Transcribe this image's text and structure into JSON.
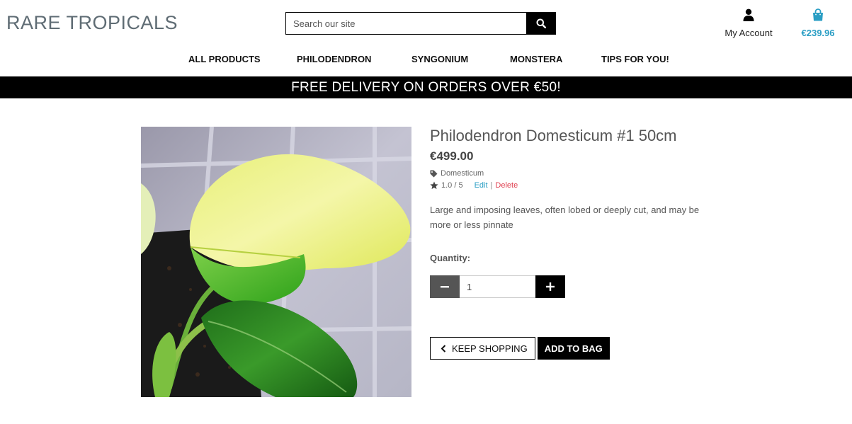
{
  "header": {
    "logo": "RARE TROPICALS",
    "search_placeholder": "Search our site",
    "account_label": "My Account",
    "bag_total": "€239.96"
  },
  "nav": {
    "items": [
      "ALL PRODUCTS",
      "PHILODENDRON",
      "SYNGONIUM",
      "MONSTERA",
      "TIPS FOR YOU!"
    ]
  },
  "banner": "FREE DELIVERY ON ORDERS OVER €50!",
  "product": {
    "title": "Philodendron Domesticum #1 50cm",
    "price": "€499.00",
    "category": "Domesticum",
    "rating": "1.0 / 5",
    "edit_label": "Edit",
    "separator": "|",
    "delete_label": "Delete",
    "description": "Large and imposing leaves, often lobed or deeply cut, and may be more or less pinnate",
    "quantity_label": "Quantity:",
    "quantity_value": "1",
    "keep_shopping_label": "KEEP SHOPPING",
    "add_to_bag_label": "ADD TO BAG"
  },
  "icons": {
    "search": "search-icon",
    "account": "user-icon",
    "bag": "shopping-bag-icon",
    "tag": "tag-icon",
    "star": "star-icon",
    "minus": "minus-icon",
    "plus": "plus-icon",
    "back": "chevron-left-icon"
  },
  "colors": {
    "accent": "#2a9ec4",
    "danger": "#e04050",
    "banner": "#000000"
  }
}
